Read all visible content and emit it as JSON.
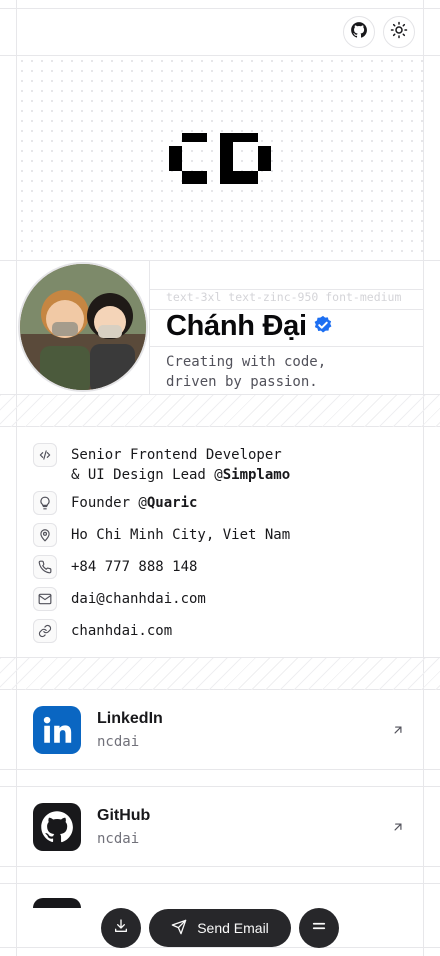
{
  "header": {
    "github_icon": "github-icon",
    "theme_icon": "sun-icon"
  },
  "banner": {
    "logo": "CD"
  },
  "profile": {
    "class_hint": "text-3xl text-zinc-950 font-medium",
    "name": "Chánh Đại",
    "verified_icon": "verified-badge-icon",
    "tagline": "Creating with code,\ndriven by passion."
  },
  "info": [
    {
      "icon": "code-icon",
      "line1": "Senior Frontend Developer",
      "line2_prefix": "& UI Design Lead @",
      "line2_bold": "Simplamo"
    },
    {
      "icon": "lightbulb-icon",
      "prefix": "Founder @",
      "bold": "Quaric"
    },
    {
      "icon": "map-pin-icon",
      "text": "Ho Chi Minh City, Viet Nam"
    },
    {
      "icon": "phone-icon",
      "text": "+84 777 888 148"
    },
    {
      "icon": "mail-icon",
      "text": "dai@chanhdai.com"
    },
    {
      "icon": "link-icon",
      "text": "chanhdai.com"
    }
  ],
  "socials": [
    {
      "name": "LinkedIn",
      "handle": "ncdai",
      "color": "#0a66c2"
    },
    {
      "name": "GitHub",
      "handle": "ncdai",
      "color": "#18181b"
    }
  ],
  "bottom_bar": {
    "download_icon": "download-icon",
    "send_label": "Send Email",
    "menu_icon": "menu-icon"
  },
  "colors": {
    "accent_verified": "#1d6ff2",
    "dark": "#27272a"
  }
}
